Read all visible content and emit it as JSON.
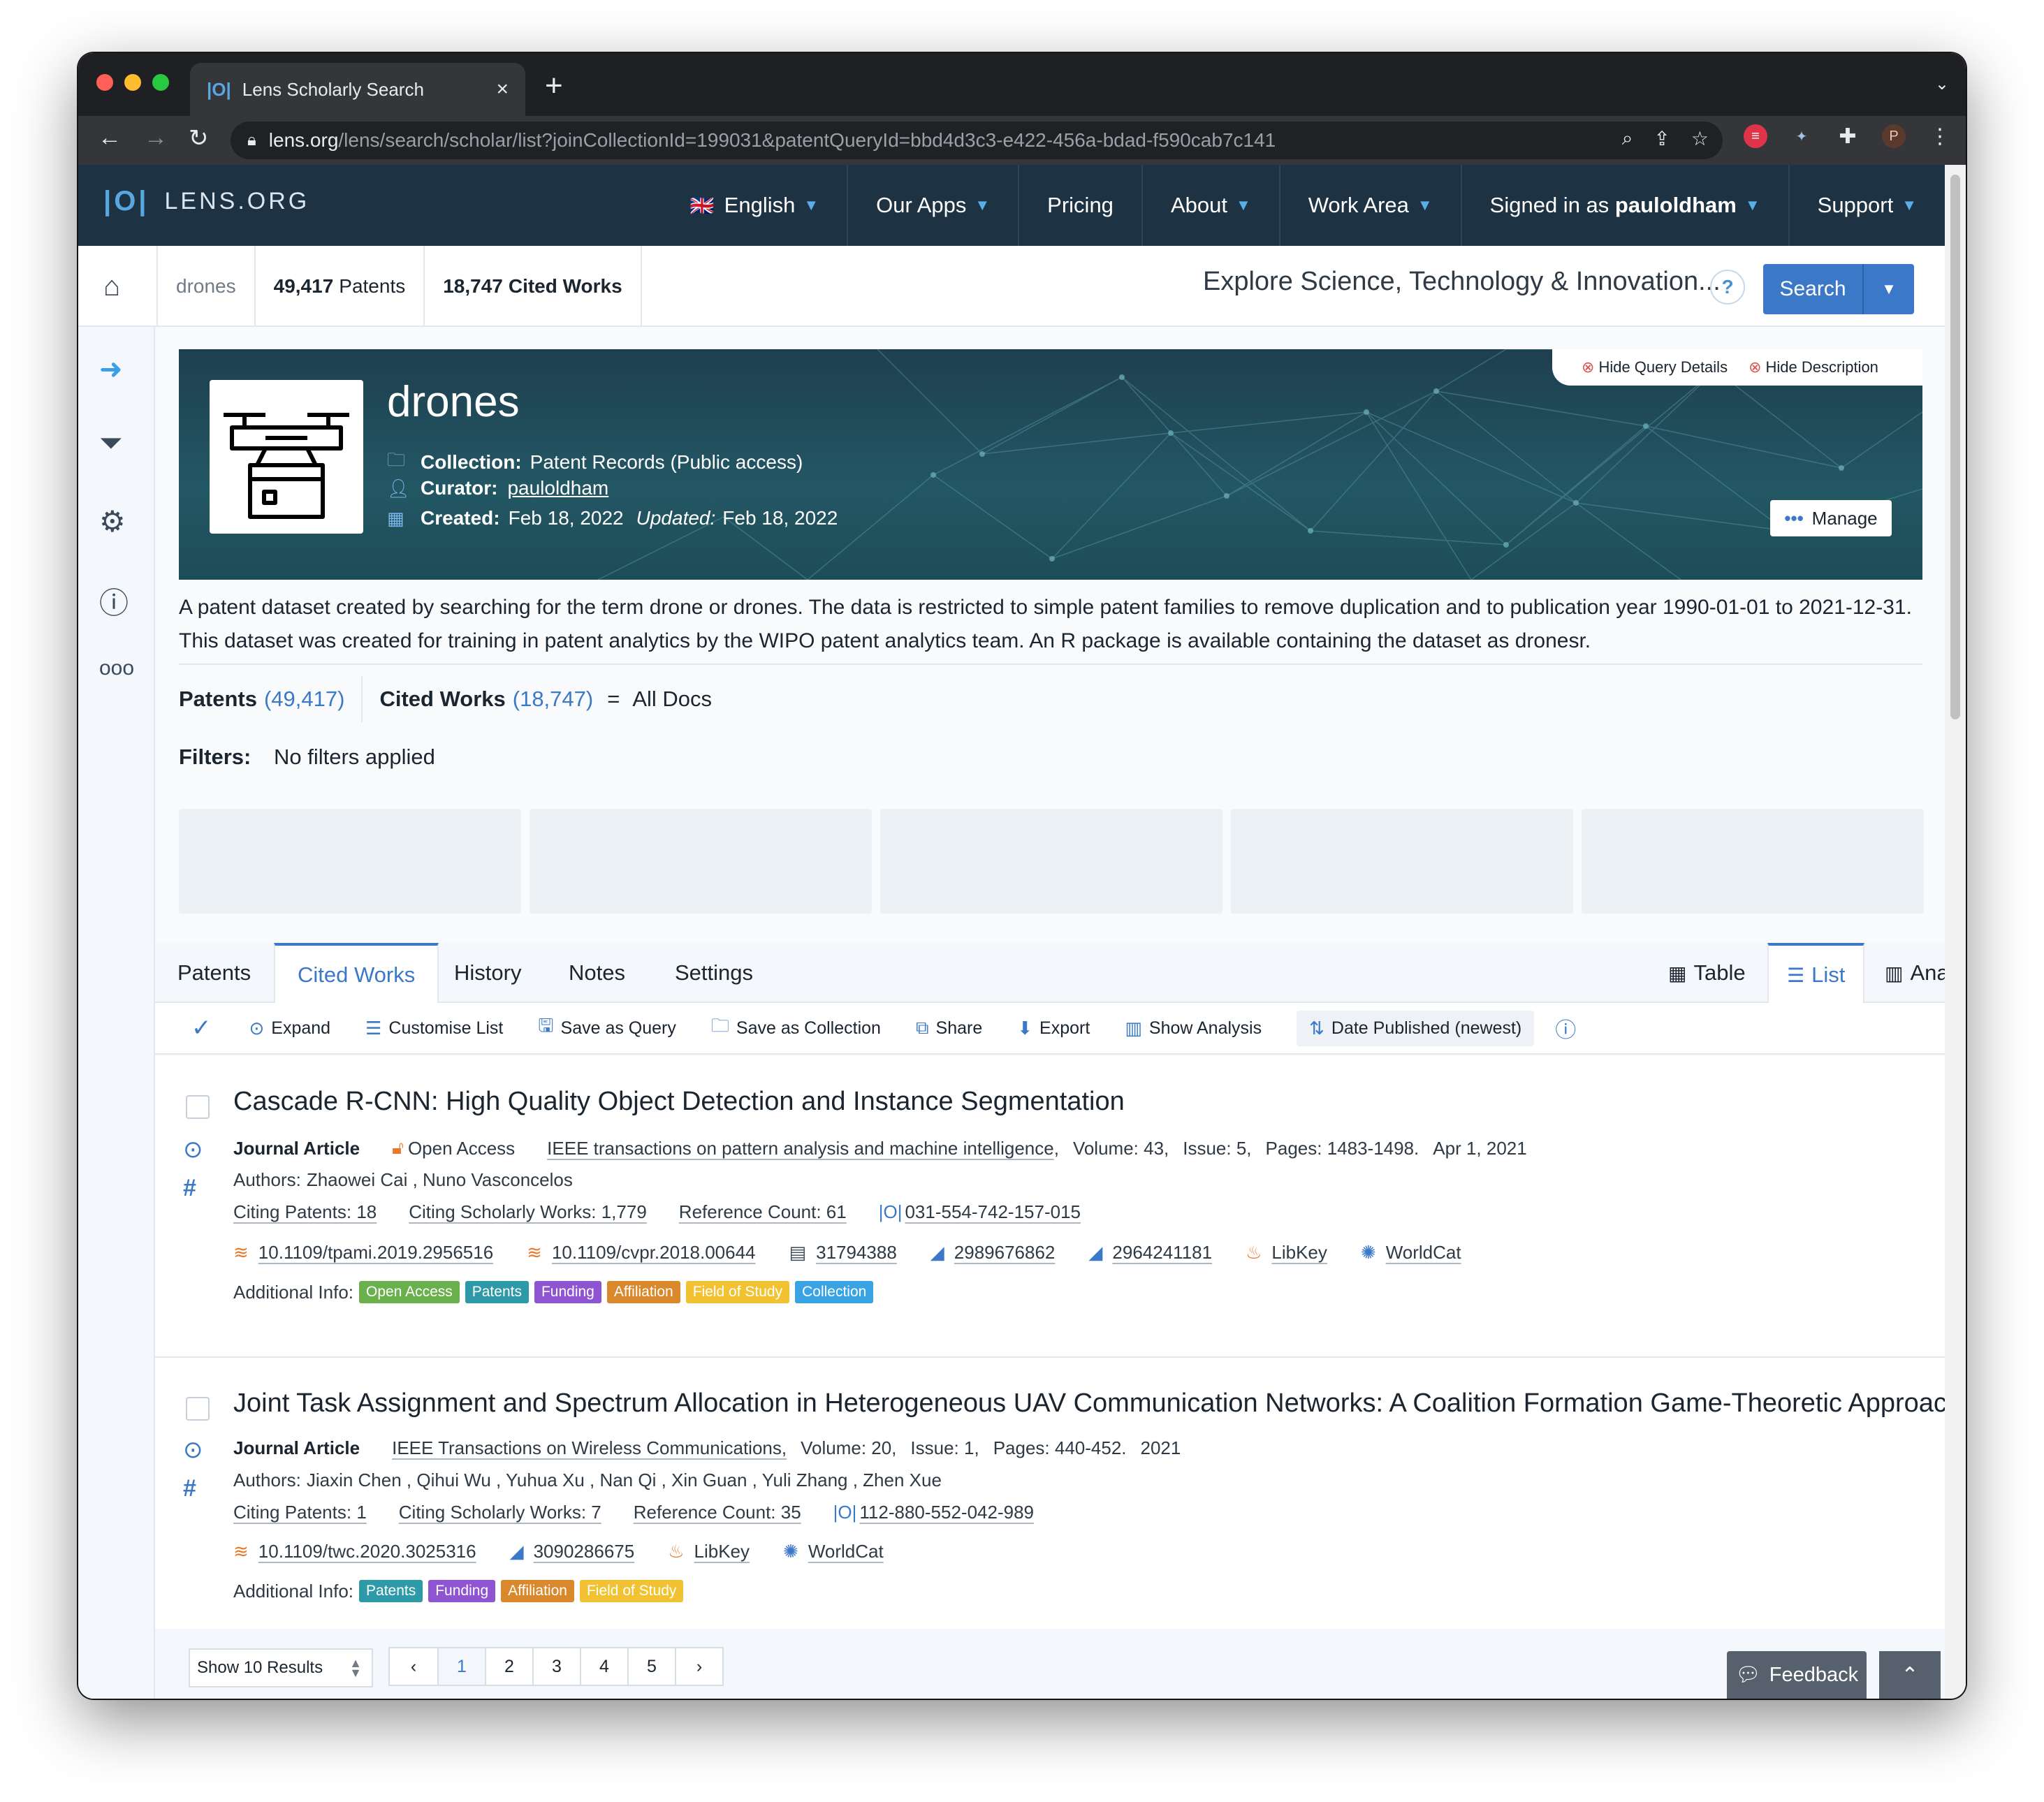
{
  "browser": {
    "tab_title": "Lens Scholarly Search",
    "url_domain": "lens.org",
    "url_path": "/lens/search/scholar/list?joinCollectionId=199031&patentQueryId=bbd4d3c3-e422-456a-bdad-f590cab7c141",
    "profile_initial": "P"
  },
  "lens_nav": {
    "logo_text": "LENS.ORG",
    "items": [
      {
        "label": "English"
      },
      {
        "label": "Our Apps"
      },
      {
        "label": "Pricing"
      },
      {
        "label": "About"
      },
      {
        "label": "Work Area"
      },
      {
        "label_prefix": "Signed in as ",
        "user": "pauloldham"
      },
      {
        "label": "Support"
      }
    ]
  },
  "breadcrumb": {
    "collection": "drones",
    "patents_count": "49,417",
    "patents_label": "Patents",
    "cited_count": "18,747",
    "cited_label": "Cited Works"
  },
  "tagline": "Explore Science, Technology & Innovation...",
  "help_label": "?",
  "search_button": "Search",
  "query_links": {
    "hide_query": "Hide Query Details",
    "hide_description": "Hide Description"
  },
  "dataset": {
    "title": "drones",
    "collection_label": "Collection:",
    "collection_value": "Patent Records (Public access)",
    "curator_label": "Curator:",
    "curator_value": "pauloldham",
    "created_label": "Created:",
    "created_value": "Feb 18, 2022",
    "updated_label": "Updated:",
    "updated_value": "Feb 18, 2022",
    "manage_label": "Manage",
    "description": "A patent dataset created by searching for the term drone or drones. The data is restricted to simple patent families to remove duplication and to publication year 1990-01-01 to 2021-12-31. This dataset was created for training in patent analytics by the WIPO patent analytics team. An R package is available containing the dataset as dronesr."
  },
  "counts": {
    "patents_label": "Patents",
    "patents_value": "(49,417)",
    "cited_label": "Cited Works",
    "cited_value": "(18,747)",
    "equals": "=",
    "all_docs": "All Docs"
  },
  "filters": {
    "label": "Filters:",
    "value": "No filters applied"
  },
  "tabs": {
    "left": [
      "Patents",
      "Cited Works",
      "History",
      "Notes",
      "Settings"
    ],
    "right": [
      "Table",
      "List",
      "Analysis"
    ],
    "active_left": "Cited Works",
    "active_right": "List"
  },
  "actions": {
    "expand": "Expand",
    "customise": "Customise List",
    "save_query": "Save as Query",
    "save_collection": "Save as Collection",
    "share": "Share",
    "export": "Export",
    "show_analysis": "Show Analysis",
    "sort": "Date Published (newest)"
  },
  "records": [
    {
      "title": "Cascade R-CNN: High Quality Object Detection and Instance Segmentation",
      "type": "Journal Article",
      "open_access": "Open Access",
      "journal": "IEEE transactions on pattern analysis and machine intelligence",
      "volume": "Volume: 43,",
      "issue": "Issue: 5,",
      "pages": "Pages: 1483-1498.",
      "date": "Apr 1, 2021",
      "authors_label": "Authors:",
      "authors": "Zhaowei Cai , Nuno Vasconcelos",
      "citing_patents": "Citing Patents: 18",
      "citing_works": "Citing Scholarly Works: 1,779",
      "ref_count": "Reference Count: 61",
      "lens_id": "031-554-742-157-015",
      "ids": [
        "10.1109/tpami.2019.2956516",
        "10.1109/cvpr.2018.00644",
        "31794388",
        "2989676862",
        "2964241181",
        "LibKey",
        "WorldCat"
      ],
      "additional_label": "Additional Info:",
      "badges": [
        "Open Access",
        "Patents",
        "Funding",
        "Affiliation",
        "Field of Study",
        "Collection"
      ]
    },
    {
      "title": "Joint Task Assignment and Spectrum Allocation in Heterogeneous UAV Communication Networks: A Coalition Formation Game-Theoretic Approach",
      "type": "Journal Article",
      "journal": "IEEE Transactions on Wireless Communications,",
      "volume": "Volume: 20,",
      "issue": "Issue: 1,",
      "pages": "Pages: 440-452.",
      "date": "2021",
      "authors_label": "Authors:",
      "authors": "Jiaxin Chen , Qihui Wu , Yuhua Xu , Nan Qi , Xin Guan , Yuli Zhang , Zhen Xue",
      "citing_patents": "Citing Patents: 1",
      "citing_works": "Citing Scholarly Works: 7",
      "ref_count": "Reference Count: 35",
      "lens_id": "112-880-552-042-989",
      "ids": [
        "10.1109/twc.2020.3025316",
        "3090286675",
        "LibKey",
        "WorldCat"
      ],
      "additional_label": "Additional Info:",
      "badges": [
        "Patents",
        "Funding",
        "Affiliation",
        "Field of Study"
      ]
    }
  ],
  "footer": {
    "show_results": "Show 10 Results",
    "pages": [
      "1",
      "2",
      "3",
      "4",
      "5"
    ],
    "current_page": "1",
    "feedback": "Feedback"
  },
  "colors": {
    "accent": "#3b79c8",
    "nav_bg": "#1d3242",
    "banner_bg": "#235764"
  }
}
